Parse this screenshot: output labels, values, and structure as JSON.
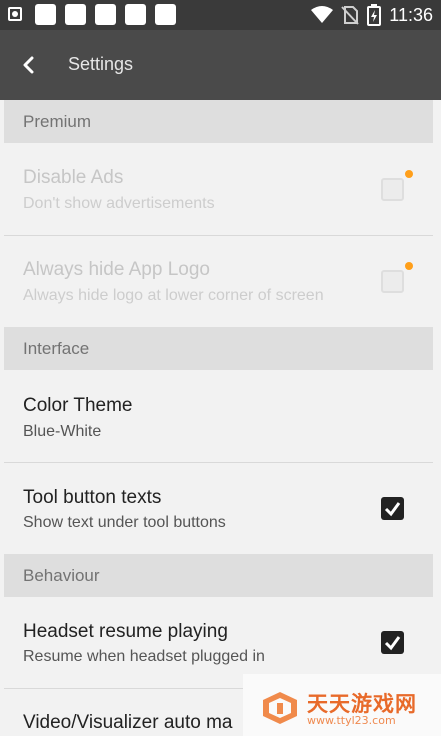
{
  "status_bar": {
    "time": "11:36",
    "icons": [
      "screenshot-icon",
      "notification-icon",
      "notification-icon",
      "notification-icon",
      "notification-icon",
      "notification-icon",
      "wifi-icon",
      "no-sim-icon",
      "battery-charging-icon"
    ]
  },
  "app_bar": {
    "title": "Settings",
    "back_icon": "chevron-left-icon"
  },
  "sections": {
    "premium": "Premium",
    "interface": "Interface",
    "behaviour": "Behaviour"
  },
  "items": {
    "disable_ads": {
      "title": "Disable Ads",
      "subtitle": "Don't show advertisements",
      "checked": false,
      "enabled": false
    },
    "hide_logo": {
      "title": "Always hide App Logo",
      "subtitle": "Always hide logo at lower corner of screen",
      "checked": false,
      "enabled": false
    },
    "color_theme": {
      "title": "Color Theme",
      "subtitle": "Blue-White"
    },
    "tool_button_texts": {
      "title": "Tool button texts",
      "subtitle": "Show text under tool buttons",
      "checked": true
    },
    "headset_resume": {
      "title": "Headset resume playing",
      "subtitle": "Resume when headset plugged in",
      "checked": true
    },
    "video_visualizer": {
      "title": "Video/Visualizer auto ma"
    }
  },
  "watermark": {
    "cn_text": "天天游戏网",
    "url": "www.ttyl23.com"
  },
  "colors": {
    "status_bar": "#3a3a3a",
    "app_bar": "#4a4a4a",
    "section_bg": "#dedede",
    "checkbox_on": "#222222",
    "premium_dot": "#ff9f1a"
  }
}
